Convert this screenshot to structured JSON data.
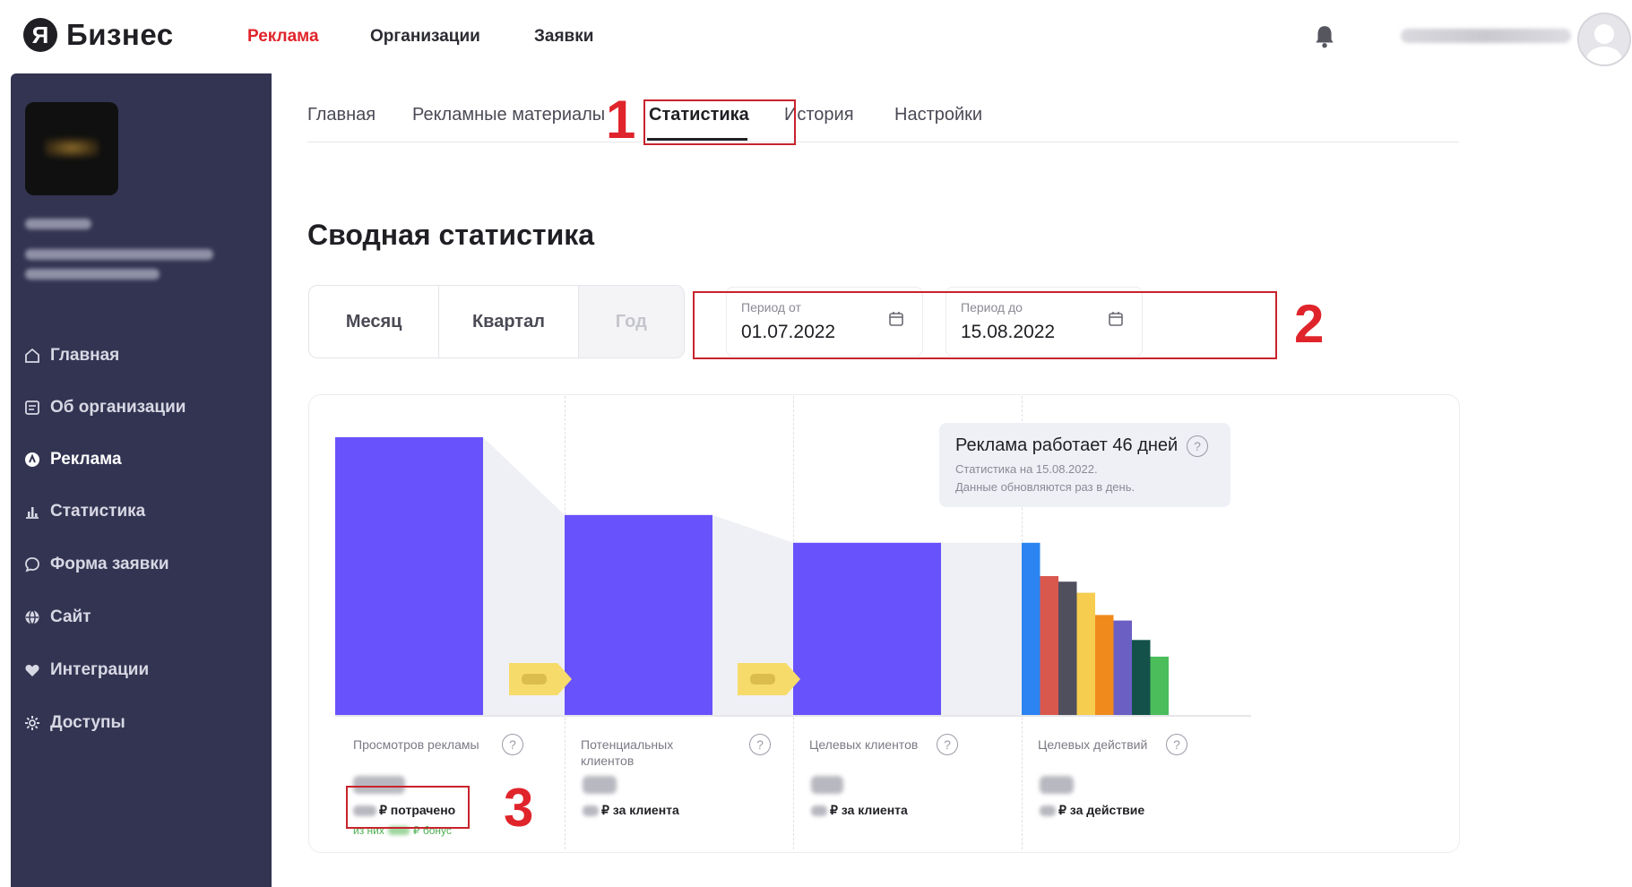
{
  "header": {
    "logo_mark": "Я",
    "logo_text": "Бизнес",
    "nav": [
      {
        "label": "Реклама",
        "active": true
      },
      {
        "label": "Организации",
        "active": false
      },
      {
        "label": "Заявки",
        "active": false
      }
    ]
  },
  "sidebar": {
    "items": [
      {
        "label": "Главная",
        "icon": "home-icon"
      },
      {
        "label": "Об организации",
        "icon": "document-icon"
      },
      {
        "label": "Реклама",
        "icon": "ad-icon",
        "active": true
      },
      {
        "label": "Статистика",
        "icon": "stats-icon"
      },
      {
        "label": "Форма заявки",
        "icon": "chat-icon"
      },
      {
        "label": "Сайт",
        "icon": "globe-icon"
      },
      {
        "label": "Интеграции",
        "icon": "heart-icon"
      },
      {
        "label": "Доступы",
        "icon": "gear-icon"
      }
    ]
  },
  "tabs": [
    {
      "label": "Главная"
    },
    {
      "label": "Рекламные материалы"
    },
    {
      "label": "Статистика",
      "active": true
    },
    {
      "label": "История"
    },
    {
      "label": "Настройки"
    }
  ],
  "annotations": [
    "1",
    "2",
    "3"
  ],
  "page_title": "Сводная статистика",
  "period": {
    "buttons": [
      "Месяц",
      "Квартал",
      "Год"
    ],
    "from_label": "Период от",
    "from_value": "01.07.2022",
    "to_label": "Период до",
    "to_value": "15.08.2022"
  },
  "info": {
    "title": "Реклама работает 46 дней",
    "line1": "Статистика на 15.08.2022.",
    "line2": "Данные обновляются раз в день."
  },
  "metrics": [
    {
      "label": "Просмотров рекламы",
      "sub": "₽ потрачено",
      "bonus_prefix": "из них",
      "bonus_suffix": "₽ бонус"
    },
    {
      "label": "Потенциальных клиентов",
      "sub": "₽ за клиента"
    },
    {
      "label": "Целевых клиентов",
      "sub": "₽ за клиента"
    },
    {
      "label": "Целевых действий",
      "sub": "₽ за действие"
    }
  ],
  "colors": {
    "funnel_bar": "#6852fb",
    "funnel_connector": "#eff0f5",
    "conversion_tag": "#f6db6b",
    "breakdown": [
      "#2b84f1",
      "#d9584e",
      "#4f4f5e",
      "#f6cd4f",
      "#f08a1c",
      "#6b5fc4",
      "#13514a",
      "#4bbe5b"
    ]
  },
  "funnel": {
    "levels": [
      1.0,
      0.72,
      0.62
    ],
    "breakdown_levels": [
      0.62,
      0.5,
      0.48,
      0.44,
      0.36,
      0.34,
      0.27,
      0.21
    ]
  }
}
